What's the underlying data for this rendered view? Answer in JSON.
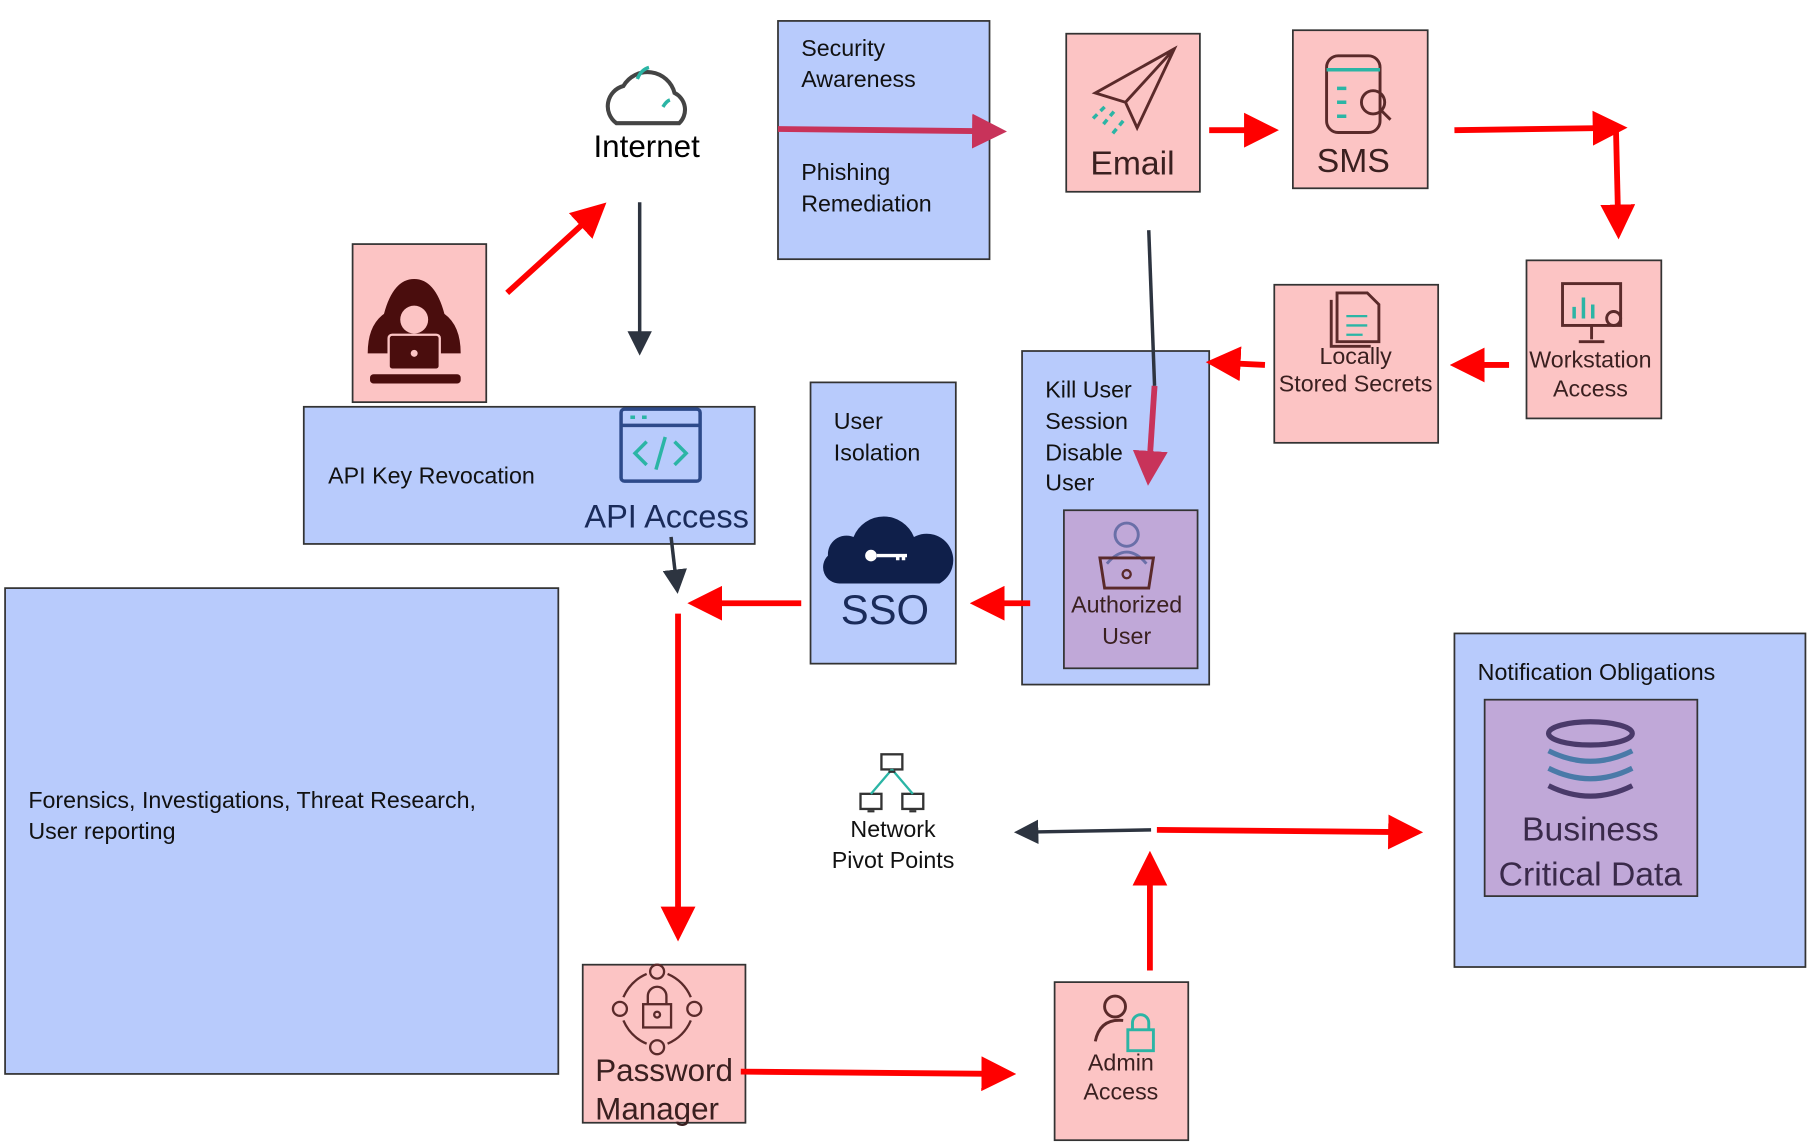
{
  "colors": {
    "box_blue": "#b8cbfc",
    "box_pink": "#fcc4c4",
    "box_purple": "#c0a8d8",
    "arrow_red": "#ff0000",
    "arrow_crimson": "#c8335a",
    "arrow_dark": "#2d3440",
    "icon_teal": "#2bb5a5"
  },
  "nodes": {
    "internet": {
      "label": "Internet",
      "icon": "cloud-icon"
    },
    "security": {
      "line1": "Security",
      "line2": "Awareness",
      "line3": "Phishing",
      "line4": "Remediation"
    },
    "email": {
      "label": "Email",
      "icon": "paper-plane-icon"
    },
    "sms": {
      "label": "SMS",
      "icon": "phone-search-icon"
    },
    "workstation": {
      "line1": "Workstation",
      "line2": "Access",
      "icon": "monitor-chart-gear-icon"
    },
    "secrets": {
      "line1": "Locally",
      "line2": "Stored Secrets",
      "icon": "document-icon"
    },
    "kill": {
      "line1": "Kill User",
      "line2": "Session",
      "line3": "Disable",
      "line4": "User"
    },
    "authorized": {
      "line1": "Authorized",
      "line2": "User",
      "icon": "user-laptop-icon"
    },
    "sso": {
      "line1": "User",
      "line2": "Isolation",
      "label": "SSO",
      "icon": "cloud-key-icon"
    },
    "hacker": {
      "icon": "hacker-icon"
    },
    "api": {
      "revocation": "API Key Revocation",
      "label": "API Access",
      "icon": "code-window-icon"
    },
    "forensics": {
      "line1": "Forensics, Investigations, Threat Research,",
      "line2": "User reporting"
    },
    "network": {
      "line1": "Network",
      "line2": "Pivot Points",
      "icon": "network-icon"
    },
    "notification": {
      "label": "Notification Obligations"
    },
    "business": {
      "line1": "Business",
      "line2": "Critical Data",
      "icon": "database-icon"
    },
    "password": {
      "line1": "Password",
      "line2": "Manager",
      "icon": "lock-cycle-icon"
    },
    "admin": {
      "line1": "Admin",
      "line2": "Access",
      "icon": "user-lock-icon"
    }
  }
}
